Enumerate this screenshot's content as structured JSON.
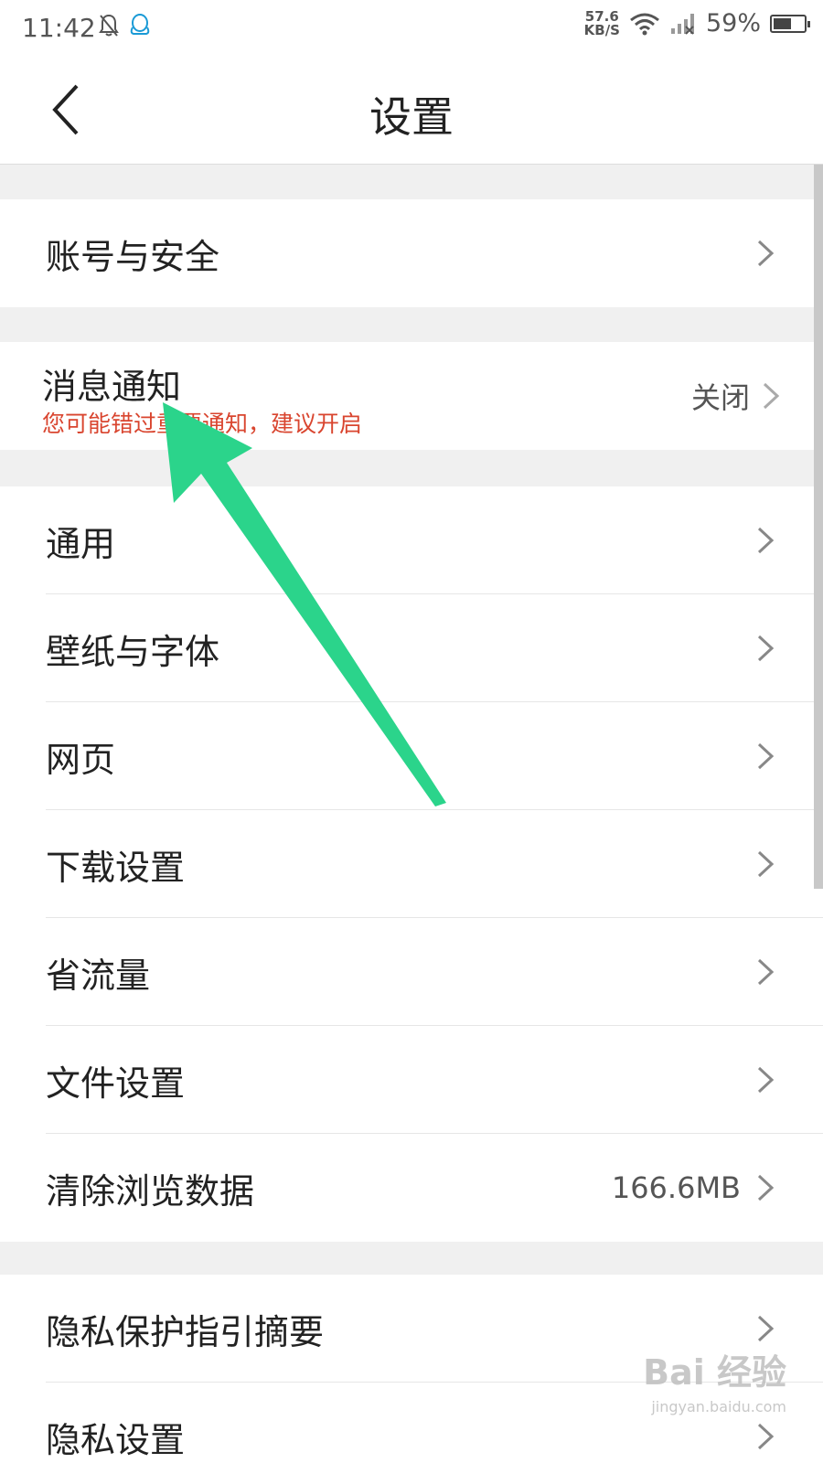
{
  "status_bar": {
    "time": "11:42",
    "speed_value": "57.6",
    "speed_unit": "KB/S",
    "battery": "59%",
    "battery_level": 0.59
  },
  "header": {
    "title": "设置"
  },
  "sections": {
    "account": {
      "label": "账号与安全"
    },
    "notify": {
      "label": "消息通知",
      "sub": "您可能错过重要通知，建议开启",
      "value": "关闭"
    },
    "general": [
      {
        "label": "通用"
      },
      {
        "label": "壁纸与字体"
      },
      {
        "label": "网页"
      },
      {
        "label": "下载设置"
      },
      {
        "label": "省流量"
      },
      {
        "label": "文件设置"
      },
      {
        "label": "清除浏览数据",
        "value": "166.6MB"
      }
    ],
    "privacy": [
      {
        "label": "隐私保护指引摘要"
      },
      {
        "label": "隐私设置"
      }
    ]
  },
  "watermark": {
    "brand": "Bai 经验",
    "url": "jingyan.baidu.com"
  },
  "colors": {
    "accent_arrow": "#2bd48b",
    "warning_text": "#d9452f"
  }
}
